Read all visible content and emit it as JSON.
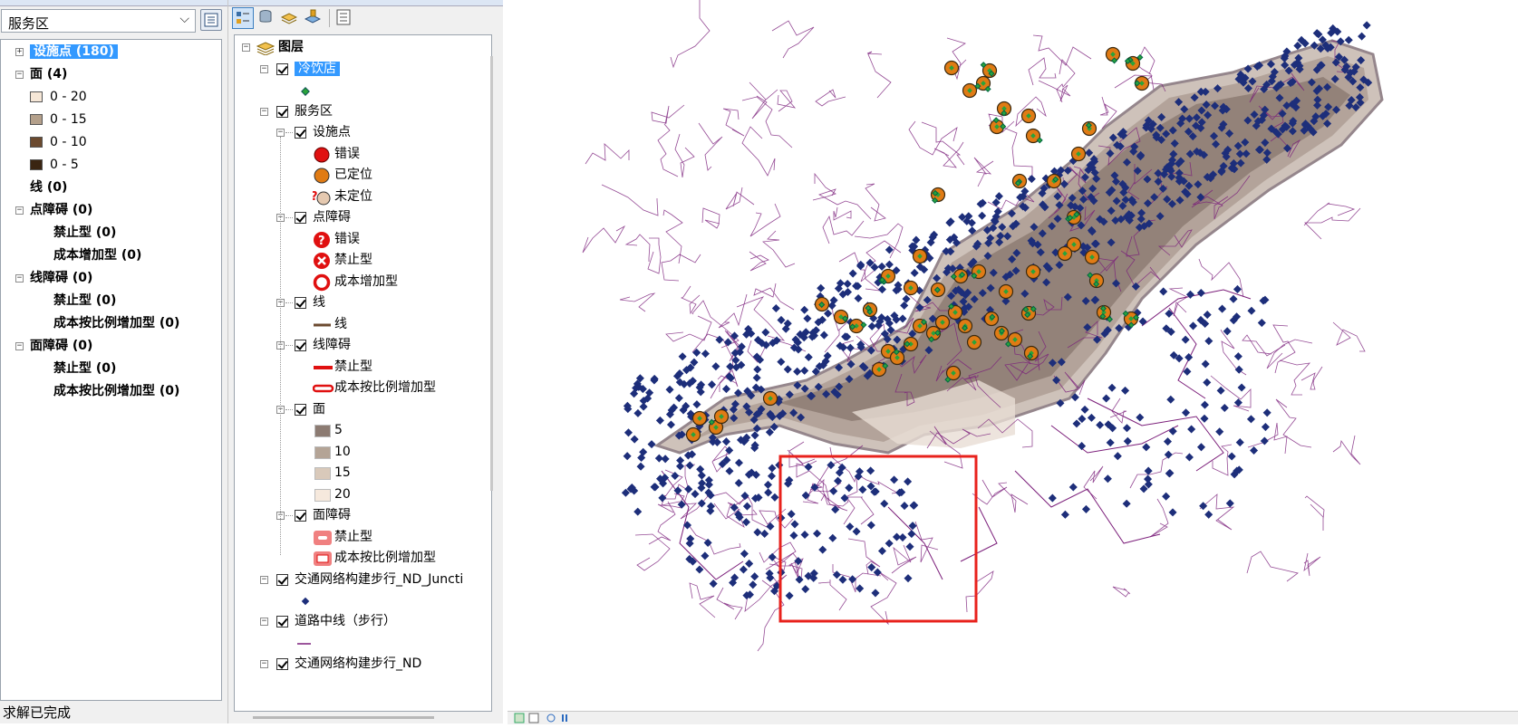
{
  "window": {
    "title": ""
  },
  "network_analysis": {
    "dropdown_value": "服务区",
    "tree": [
      {
        "label": "设施点 (180)",
        "bold": true,
        "expand": "+",
        "selected": true,
        "indent": 0
      },
      {
        "label": "面 (4)",
        "bold": true,
        "expand": "−",
        "indent": 0
      },
      {
        "label": "0 - 20",
        "swatch": "#f6e7d7",
        "indent": 1
      },
      {
        "label": "0 - 15",
        "swatch": "#b4a08b",
        "indent": 1
      },
      {
        "label": "0 - 10",
        "swatch": "#6b4a2f",
        "indent": 1
      },
      {
        "label": "0 - 5",
        "swatch": "#3a2512",
        "indent": 1
      },
      {
        "label": "线 (0)",
        "bold": true,
        "indent": 0
      },
      {
        "label": "点障碍 (0)",
        "bold": true,
        "expand": "−",
        "indent": 0
      },
      {
        "label": "禁止型 (0)",
        "bold": true,
        "indent": 2
      },
      {
        "label": "成本增加型 (0)",
        "bold": true,
        "indent": 2
      },
      {
        "label": "线障碍 (0)",
        "bold": true,
        "expand": "−",
        "indent": 0
      },
      {
        "label": "禁止型 (0)",
        "bold": true,
        "indent": 2
      },
      {
        "label": "成本按比例增加型 (0)",
        "bold": true,
        "indent": 2
      },
      {
        "label": "面障碍 (0)",
        "bold": true,
        "expand": "−",
        "indent": 0
      },
      {
        "label": "禁止型 (0)",
        "bold": true,
        "indent": 2
      },
      {
        "label": "成本按比例增加型 (0)",
        "bold": true,
        "indent": 2
      }
    ],
    "status": "求解已完成"
  },
  "toc": {
    "root": "图层",
    "items": [
      {
        "label": "冷饮店",
        "kind": "layer",
        "checked": true,
        "selected": true,
        "level": 0
      },
      {
        "label": "",
        "kind": "sym",
        "icon": "green-diamond",
        "level": 1
      },
      {
        "label": "服务区",
        "kind": "layer",
        "checked": true,
        "level": 0
      },
      {
        "label": "设施点",
        "kind": "sublayer",
        "checked": true,
        "level": 1
      },
      {
        "label": "错误",
        "kind": "sym",
        "icon": "red-circle",
        "level": 2
      },
      {
        "label": "已定位",
        "kind": "sym",
        "icon": "orange-circle",
        "level": 2
      },
      {
        "label": "未定位",
        "kind": "sym",
        "icon": "question-circle",
        "level": 2
      },
      {
        "label": "点障碍",
        "kind": "sublayer",
        "checked": true,
        "level": 1
      },
      {
        "label": "错误",
        "kind": "sym",
        "icon": "red-question",
        "level": 2
      },
      {
        "label": "禁止型",
        "kind": "sym",
        "icon": "red-x",
        "level": 2
      },
      {
        "label": "成本增加型",
        "kind": "sym",
        "icon": "red-ring",
        "level": 2
      },
      {
        "label": "线",
        "kind": "sublayer",
        "checked": true,
        "level": 1
      },
      {
        "label": "线",
        "kind": "sym",
        "icon": "brown-line",
        "level": 2
      },
      {
        "label": "线障碍",
        "kind": "sublayer",
        "checked": true,
        "level": 1
      },
      {
        "label": "禁止型",
        "kind": "sym",
        "icon": "red-line",
        "level": 2
      },
      {
        "label": "成本按比例增加型",
        "kind": "sym",
        "icon": "red-hollow-line",
        "level": 2
      },
      {
        "label": "面",
        "kind": "sublayer",
        "checked": true,
        "level": 1
      },
      {
        "label": "5",
        "kind": "sym",
        "icon": "swatch",
        "color": "#8c7b72",
        "level": 2
      },
      {
        "label": "10",
        "kind": "sym",
        "icon": "swatch",
        "color": "#b4a496",
        "level": 2
      },
      {
        "label": "15",
        "kind": "sym",
        "icon": "swatch",
        "color": "#d9c9ba",
        "level": 2
      },
      {
        "label": "20",
        "kind": "sym",
        "icon": "swatch",
        "color": "#f6e9dd",
        "level": 2
      },
      {
        "label": "面障碍",
        "kind": "sublayer",
        "checked": true,
        "level": 1
      },
      {
        "label": "禁止型",
        "kind": "sym",
        "icon": "red-poly",
        "level": 2
      },
      {
        "label": "成本按比例增加型",
        "kind": "sym",
        "icon": "red-poly-hollow",
        "level": 2
      },
      {
        "label": "交通网络构建步行_ND_Juncti",
        "kind": "layer",
        "checked": true,
        "level": 0
      },
      {
        "label": "",
        "kind": "sym",
        "icon": "navy-diamond",
        "level": 1
      },
      {
        "label": "道路中线（步行）",
        "kind": "layer",
        "checked": true,
        "level": 0
      },
      {
        "label": "",
        "kind": "sym",
        "icon": "purple-line",
        "level": 1
      },
      {
        "label": "交通网络构建步行_ND",
        "kind": "layer",
        "checked": true,
        "level": 0
      }
    ]
  },
  "map": {
    "colors": {
      "outer": "#c9bcb3",
      "mid": "#9d8a80",
      "inner": "#6d5a52",
      "core": "#e8ddd4",
      "junction": "#1d2e7a",
      "road": "#7b1e7a",
      "facility": "#e07b14",
      "shop": "#2aa33b",
      "highlight": "#e8221c"
    }
  }
}
